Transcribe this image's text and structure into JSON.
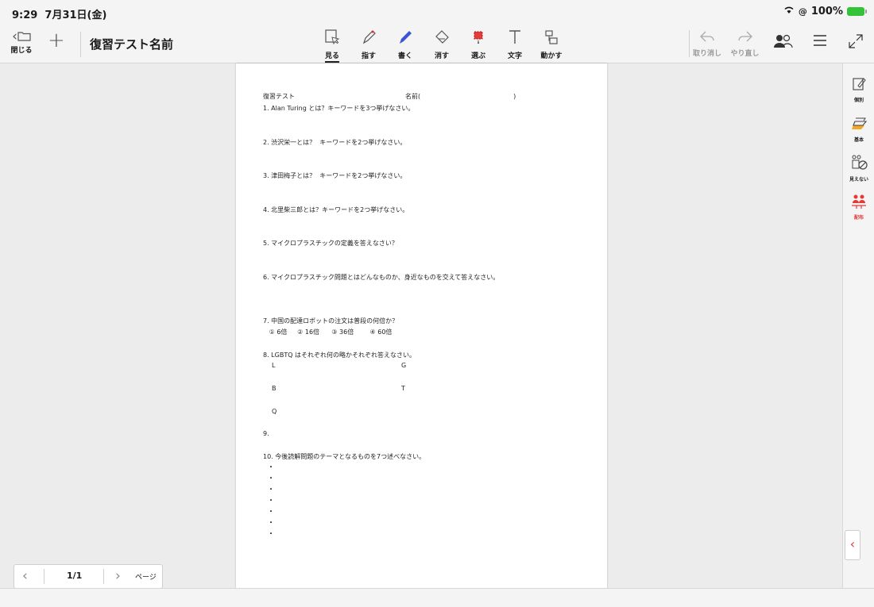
{
  "status": {
    "time": "9:29",
    "date": "7月31日(金)",
    "battery": "100%"
  },
  "toolbar": {
    "close_label": "閉じる",
    "title": "復習テスト名前",
    "tools": [
      {
        "label": "見る",
        "icon": "view-icon"
      },
      {
        "label": "指す",
        "icon": "pointer-pen-icon"
      },
      {
        "label": "書く",
        "icon": "pen-icon"
      },
      {
        "label": "消す",
        "icon": "eraser-icon"
      },
      {
        "label": "選ぶ",
        "icon": "select-icon"
      },
      {
        "label": "文字",
        "icon": "text-icon"
      },
      {
        "label": "動かす",
        "icon": "move-icon"
      }
    ],
    "undo_label": "取り消し",
    "redo_label": "やり直し",
    "accent_color": "#3a56d4"
  },
  "document": {
    "header_left": "復習テスト",
    "header_right": "名前(                                              )",
    "lines": [
      "1. Alan Turing とは？キーワードを3つ挙げなさい。",
      "2. 渋沢栄一とは？  キーワードを2つ挙げなさい。",
      "3. 津田梅子とは？  キーワードを2つ挙げなさい。",
      "4. 北里柴三郎とは？キーワードを2つ挙げなさい。",
      "5. マイクロプラスチックの定義を答えなさい？",
      "6. マイクロプラスチック問題とはどんなものか、身近なものを交えて答えなさい。",
      "7. 中国の配達ロボットの注文は普段の何倍か？",
      "   ① 6倍     ② 16倍      ③ 36倍        ④ 60倍",
      "8. LGBTQ はそれぞれ何の略かそれぞれ答えなさい。",
      "L",
      "G",
      "B",
      "T",
      "Q",
      "9.",
      "10. 今後読解問題のテーマとなるものを7つ述べなさい。"
    ],
    "bullets": [
      "・",
      "・",
      "・",
      "・",
      "・",
      "・",
      "・"
    ]
  },
  "right_panel": [
    {
      "label": "個別",
      "icon": "individual-icon"
    },
    {
      "label": "基本",
      "icon": "layers-icon"
    },
    {
      "label": "見えない",
      "icon": "hidden-icon"
    },
    {
      "label": "配布",
      "icon": "distribute-icon"
    }
  ],
  "pagenav": {
    "count": "1/1",
    "label": "ページ"
  }
}
